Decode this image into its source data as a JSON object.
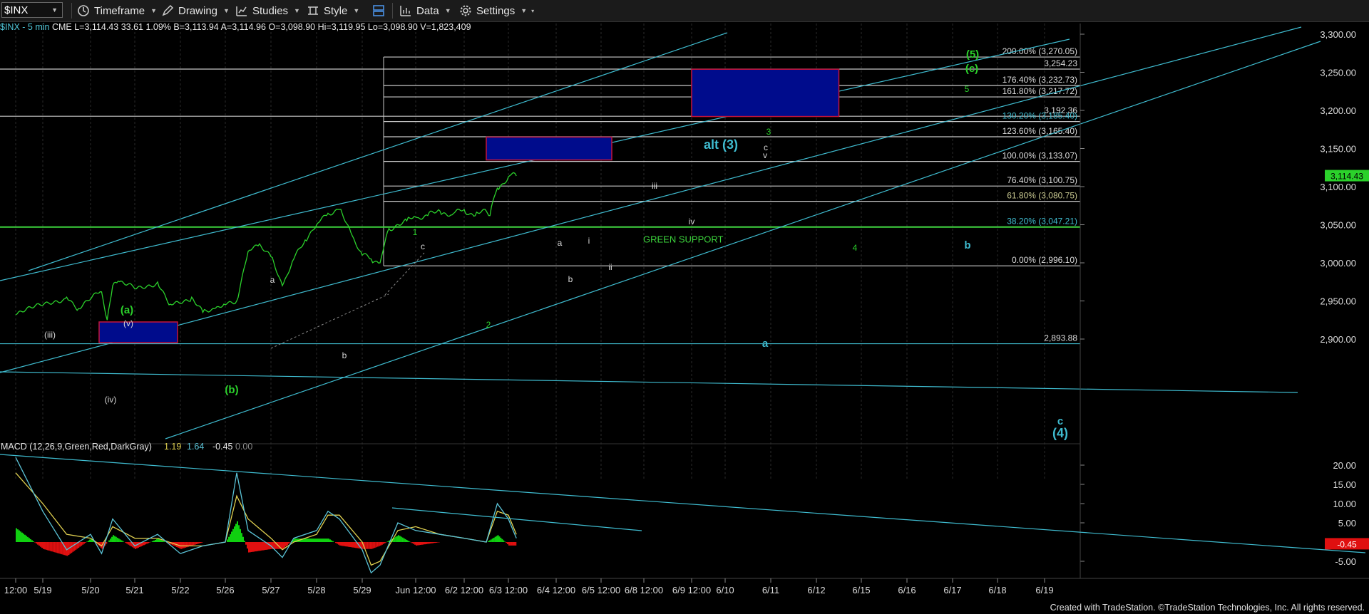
{
  "toolbar": {
    "symbol": "$INX",
    "timeframe": "Timeframe",
    "drawing": "Drawing",
    "studies": "Studies",
    "style": "Style",
    "data": "Data",
    "settings": "Settings"
  },
  "infobar": {
    "symbol": "$INX - 5 min",
    "exchange": "CME",
    "last": "L=3,114.43",
    "change": "33.61",
    "pct": "1.09%",
    "bid": "B=3,113.94",
    "ask": "A=3,114.96",
    "open": "O=3,098.90",
    "high": "Hi=3,119.95",
    "low": "Lo=3,098.90",
    "volume": "V=1,823,409"
  },
  "colors": {
    "price": "#2bd12b",
    "cyan": "#3fbcd0",
    "white_line": "#c8c8c8",
    "green_support": "#3cd43c",
    "box_fill": "#000c8c",
    "box_border": "#c4143c",
    "macd_pos": "#10d010",
    "macd_neg": "#e01010",
    "macd_line": "#5bc4d8",
    "signal_line": "#e0d050"
  },
  "chart_data": {
    "type": "line",
    "title": "$INX - 5 min",
    "x_ticks": [
      "12:00",
      "5/19",
      "5/20",
      "5/21",
      "5/22",
      "5/26",
      "5/27",
      "5/28",
      "5/29",
      "Jun 12:00",
      "6/2 12:00",
      "6/3 12:00",
      "6/4 12:00",
      "6/5 12:00",
      "6/8 12:00",
      "6/9 12:00",
      "6/10",
      "6/11",
      "6/12",
      "6/15",
      "6/16",
      "6/17",
      "6/18",
      "6/19"
    ],
    "y_ticks": [
      "3,300.00",
      "3,250.00",
      "3,200.00",
      "3,150.00",
      "3,100.00",
      "3,050.00",
      "3,000.00",
      "2,950.00",
      "2,900.00"
    ],
    "ylim": [
      2870,
      3313
    ],
    "last_price_label": "3,114.43",
    "series": [
      {
        "name": "$INX",
        "x": [
          "5/18 12:00",
          "5/19 12:00",
          "5/19 18:00",
          "5/20 06:00",
          "5/20 09:00",
          "5/20 12:00",
          "5/20 15:00",
          "5/21 00:00",
          "5/21 12:00",
          "5/21 18:00",
          "5/22 06:00",
          "5/22 12:00",
          "5/22 18:00",
          "5/26 00:00",
          "5/26 06:00",
          "5/26 12:00",
          "5/26 18:00",
          "5/27 00:00",
          "5/27 06:00",
          "5/27 12:00",
          "5/27 18:00",
          "5/28 00:00",
          "5/28 06:00",
          "5/28 12:00",
          "5/28 18:00",
          "5/29 00:00",
          "5/29 06:00",
          "5/29 12:00",
          "5/29 18:00",
          "6/1 06:00",
          "6/1 12:00",
          "6/1 18:00",
          "6/2 00:00",
          "6/2 06:00",
          "6/2 12:00",
          "6/2 18:00",
          "6/3 00:00",
          "6/3 02:00",
          "6/3 06:00",
          "6/3 12:00",
          "6/3 16:00"
        ],
        "y": [
          2932,
          2955,
          2940,
          2962,
          2925,
          2970,
          2976,
          2966,
          2975,
          2945,
          2955,
          2935,
          2940,
          2945,
          2950,
          3015,
          3025,
          3008,
          2970,
          3005,
          3030,
          3050,
          3065,
          3070,
          3040,
          3010,
          3005,
          3000,
          3045,
          3055,
          3060,
          3062,
          3068,
          3063,
          3070,
          3062,
          3068,
          3062,
          3098,
          3113,
          3114
        ]
      }
    ],
    "horizontal_levels": [
      {
        "value": 3270.05,
        "label": "200.00% (3,270.05)"
      },
      {
        "value": 3254.23,
        "label": "3,254.23"
      },
      {
        "value": 3232.73,
        "label": "176.40% (3,232.73)"
      },
      {
        "value": 3217.72,
        "label": "161.80% (3,217.72)"
      },
      {
        "value": 3192.36,
        "label": "3,192.36"
      },
      {
        "value": 3185.4,
        "label": "130.20% (3,185.40)"
      },
      {
        "value": 3165.4,
        "label": "123.60% (3,165.40)"
      },
      {
        "value": 3133.07,
        "label": "100.00% (3,133.07)"
      },
      {
        "value": 3100.75,
        "label": "76.40% (3,100.75)"
      },
      {
        "value": 3080.75,
        "label": "61.80% (3,080.75)"
      },
      {
        "value": 3047.21,
        "label": "38.20% (3,047.21)"
      },
      {
        "value": 2996.1,
        "label": "0.00% (2,996.10)"
      },
      {
        "value": 2893.88,
        "label": "2,893.88"
      }
    ],
    "green_support": {
      "value": 3047,
      "label": "GREEN SUPPORT"
    },
    "target_boxes": [
      {
        "from": "6/3 00:00",
        "to": "6/5 18:00",
        "low": 3135,
        "high": 3165
      },
      {
        "from": "6/9 12:00",
        "to": "6/12 12:00",
        "low": 3192,
        "high": 3254
      }
    ],
    "wave_labels": [
      "(iii)",
      "(iv)",
      "(v)",
      "(a)",
      "(b)",
      "a",
      "b",
      "c",
      "1",
      "2",
      "3",
      "4",
      "5",
      "a",
      "b",
      "i",
      "ii",
      "iii",
      "iv",
      "v",
      "c",
      "alt (3)",
      "(5)",
      "(c)",
      "a",
      "b",
      "c",
      "(4)"
    ],
    "macd": {
      "name": "MACD (12,26,9,Green,Red,DarkGray)",
      "values": {
        "macd": "1.19",
        "signal": "1.64",
        "hist": "-0.45",
        "zero": "0.00"
      },
      "y_ticks": [
        "20.00",
        "15.00",
        "10.00",
        "5.00",
        "-5.00"
      ],
      "last_label": "-0.45",
      "ylim": [
        -9,
        23
      ],
      "x": [
        "5/18 12:00",
        "5/19 00:00",
        "5/19 12:00",
        "5/20 00:00",
        "5/20 06:00",
        "5/20 12:00",
        "5/21 00:00",
        "5/21 12:00",
        "5/22 00:00",
        "5/22 12:00",
        "5/26 00:00",
        "5/26 06:00",
        "5/26 12:00",
        "5/27 00:00",
        "5/27 06:00",
        "5/27 12:00",
        "5/28 00:00",
        "5/28 06:00",
        "5/28 12:00",
        "5/29 00:00",
        "5/29 06:00",
        "5/29 12:00",
        "6/1 00:00",
        "6/1 12:00",
        "6/2 00:00",
        "6/2 12:00",
        "6/3 00:00",
        "6/3 06:00",
        "6/3 12:00",
        "6/3 16:00"
      ],
      "macd_line": [
        22,
        8,
        -2,
        2,
        -3,
        6,
        -1,
        2,
        -3,
        -1,
        0,
        18,
        3,
        -1,
        -4,
        1,
        3,
        8,
        6,
        -2,
        -8,
        -6,
        5,
        3,
        2,
        1,
        0,
        10,
        6,
        1
      ],
      "signal_line": [
        18,
        10,
        2,
        1,
        -1,
        4,
        1,
        1,
        -1,
        -1,
        0,
        12,
        6,
        1,
        -2,
        0,
        2,
        7,
        7,
        0,
        -6,
        -5,
        3,
        4,
        2,
        1,
        0,
        8,
        7,
        2
      ]
    }
  },
  "footer": "Created with TradeStation. ©TradeStation Technologies, Inc. All rights reserved."
}
